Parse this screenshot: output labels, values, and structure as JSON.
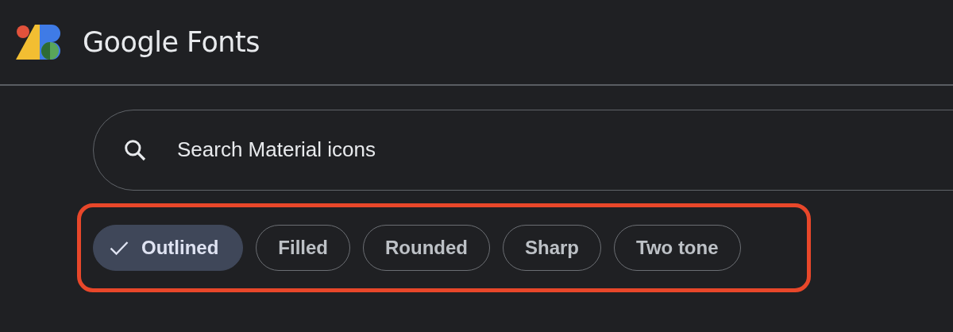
{
  "header": {
    "brand": "Google Fonts"
  },
  "search": {
    "placeholder": "Search Material icons"
  },
  "highlight": {
    "color": "#e8472a"
  },
  "styles": [
    {
      "label": "Outlined",
      "selected": true
    },
    {
      "label": "Filled",
      "selected": false
    },
    {
      "label": "Rounded",
      "selected": false
    },
    {
      "label": "Sharp",
      "selected": false
    },
    {
      "label": "Two tone",
      "selected": false
    }
  ]
}
